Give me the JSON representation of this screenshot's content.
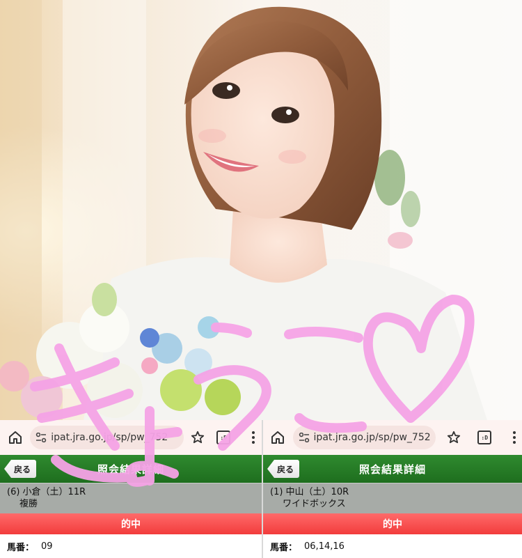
{
  "photo": {
    "subject": "portrait-photo"
  },
  "overlay": {
    "handwritten_text": "きょうこ♡",
    "color": "#f5a3e6"
  },
  "left_screen": {
    "url": "ipat.jra.go.jp/sp/pw_752",
    "back_label": "戻る",
    "title": "照会結果詳細",
    "race_line": "(6) 小倉（土）11R",
    "bet_type": "複勝",
    "status": "的中",
    "number_label": "馬番：",
    "number_value": "09"
  },
  "right_screen": {
    "url_prefix": "ipat.jra",
    "url": ".go.jp/sp/pw_752",
    "back_label": "戻る",
    "title": "照会結果詳細",
    "race_line": "(1) 中山（土）10R",
    "bet_type": "ワイドボックス",
    "status": "的中",
    "number_label": "馬番：",
    "number_value": "06,14,16"
  },
  "colors": {
    "title_bar_green": "#237a23",
    "hit_red": "#f24a4a",
    "info_gray": "#a7aba7",
    "browser_bar": "#fdf3f1"
  }
}
